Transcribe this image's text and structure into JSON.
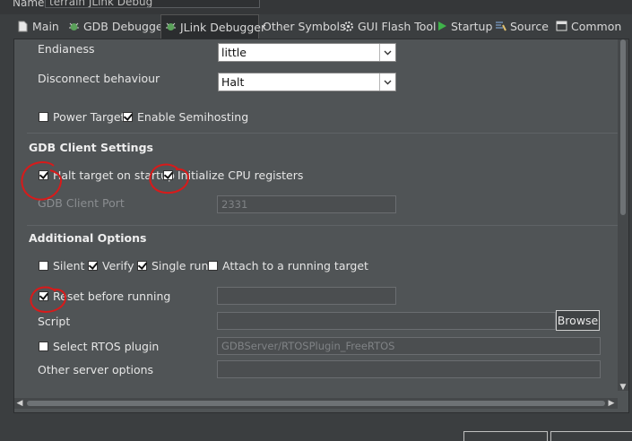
{
  "header": {
    "label": "Name:",
    "value": "terrain JLink Debug"
  },
  "tabs": [
    {
      "label": "Main",
      "icon": "page-icon"
    },
    {
      "label": "GDB Debugger",
      "icon": "bug-icon"
    },
    {
      "label": "JLink Debugger",
      "icon": "bug-icon",
      "active": true
    },
    {
      "label": "Other Symbols",
      "icon": ""
    },
    {
      "label": "GUI Flash Tool",
      "icon": "gear-icon"
    },
    {
      "label": "Startup",
      "icon": "play-icon"
    },
    {
      "label": "Source",
      "icon": "source-icon"
    },
    {
      "label": "Common",
      "icon": "window-icon"
    }
  ],
  "target": {
    "endianess_label": "Endianess",
    "endianess_value": "little",
    "disconnect_label": "Disconnect behaviour",
    "disconnect_value": "Halt",
    "power_target": "Power Target",
    "power_target_checked": false,
    "semihosting": "Enable Semihosting",
    "semihosting_checked": true
  },
  "gdb_client": {
    "title": "GDB Client Settings",
    "halt": "Halt target on startup",
    "halt_checked": true,
    "init_cpu": "Initialize CPU registers",
    "init_cpu_checked": true,
    "port_label": "GDB Client Port",
    "port_value": "2331"
  },
  "additional": {
    "title": "Additional Options",
    "silent": "Silent",
    "silent_checked": false,
    "verify": "Verify",
    "verify_checked": true,
    "single_run": "Single run",
    "single_run_checked": true,
    "attach": "Attach to a running target",
    "attach_checked": false,
    "reset": "Reset before running",
    "reset_checked": true,
    "script_label": "Script",
    "browse": "Browse",
    "rtos": "Select RTOS plugin",
    "rtos_checked": false,
    "rtos_value": "GDBServer/RTOSPlugin_FreeRTOS",
    "other_label": "Other server options"
  },
  "colors": {
    "annotation": "#d81a1a",
    "panel": "#505456"
  }
}
